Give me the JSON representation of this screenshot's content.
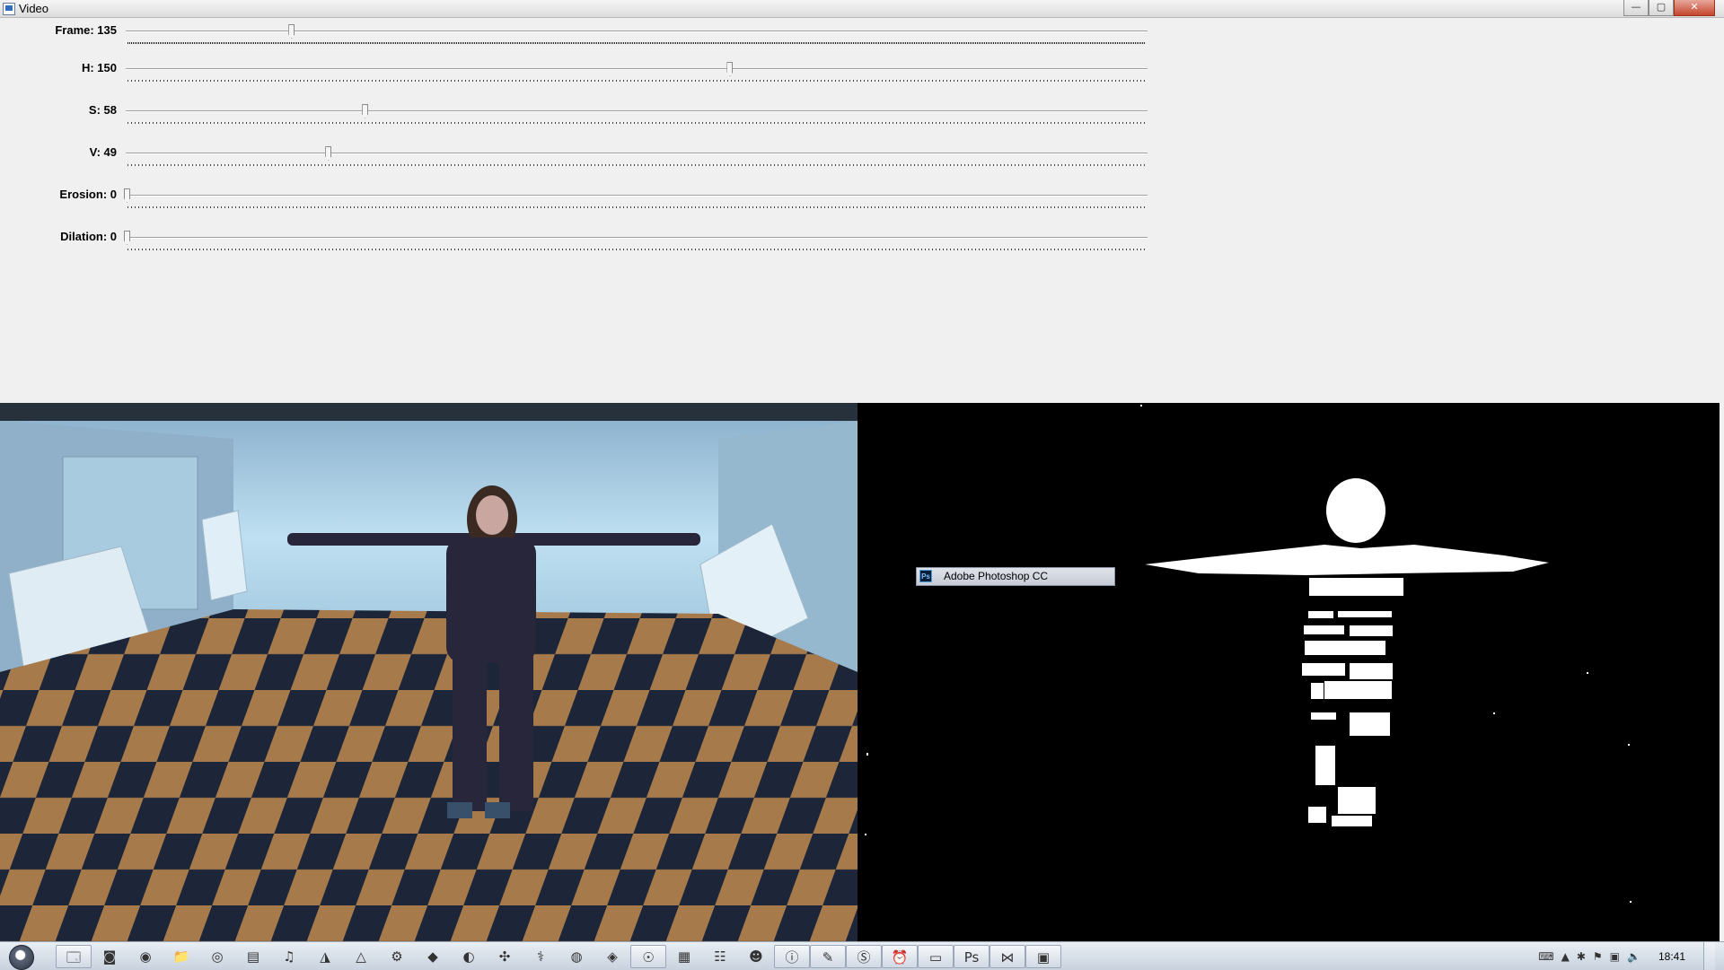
{
  "window": {
    "title": "Video",
    "controls": {
      "minimize": "—",
      "maximize": "▢",
      "close": "✕"
    }
  },
  "trackbars": [
    {
      "label": "Frame: 135",
      "fraction": 0.161
    },
    {
      "label": "H: 150",
      "fraction": 0.59
    },
    {
      "label": "S: 58",
      "fraction": 0.233
    },
    {
      "label": "V: 49",
      "fraction": 0.197
    },
    {
      "label": "Erosion: 0",
      "fraction": 0.0
    },
    {
      "label": "Dilation: 0",
      "fraction": 0.0
    }
  ],
  "taskbar_popup": {
    "icon": "Ps",
    "label": "Adobe Photoshop CC"
  },
  "taskbar": {
    "icons": [
      {
        "name": "explorer",
        "glyph": "🗔"
      },
      {
        "name": "outlook",
        "glyph": "◙"
      },
      {
        "name": "skype-blue",
        "glyph": "◉"
      },
      {
        "name": "folder",
        "glyph": "📁"
      },
      {
        "name": "chrome",
        "glyph": "◎"
      },
      {
        "name": "notepad",
        "glyph": "▤"
      },
      {
        "name": "spotify",
        "glyph": "♫"
      },
      {
        "name": "matlab",
        "glyph": "◮"
      },
      {
        "name": "vlc",
        "glyph": "△"
      },
      {
        "name": "blender",
        "glyph": "⚙"
      },
      {
        "name": "git",
        "glyph": "◆"
      },
      {
        "name": "ubuntu",
        "glyph": "◐"
      },
      {
        "name": "puzzle",
        "glyph": "✣"
      },
      {
        "name": "python",
        "glyph": "⚕"
      },
      {
        "name": "globe",
        "glyph": "◍"
      },
      {
        "name": "unity",
        "glyph": "◈"
      },
      {
        "name": "steam",
        "glyph": "☉"
      },
      {
        "name": "calculator",
        "glyph": "▦"
      },
      {
        "name": "gamepad",
        "glyph": "☷"
      },
      {
        "name": "game",
        "glyph": "☻"
      },
      {
        "name": "info",
        "glyph": "ⓘ"
      },
      {
        "name": "paint",
        "glyph": "✎"
      },
      {
        "name": "skype",
        "glyph": "Ⓢ"
      },
      {
        "name": "alarm",
        "glyph": "⏰"
      },
      {
        "name": "window",
        "glyph": "▭"
      },
      {
        "name": "photoshop",
        "glyph": "Ps"
      },
      {
        "name": "visual-studio",
        "glyph": "⋈"
      },
      {
        "name": "video-window",
        "glyph": "▣"
      }
    ],
    "clock": "18:41"
  }
}
